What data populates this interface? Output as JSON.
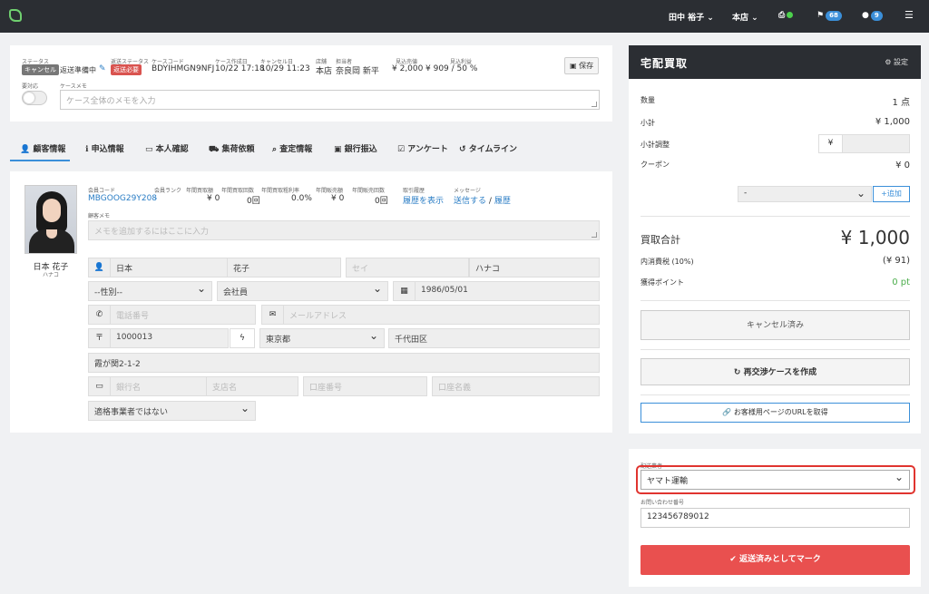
{
  "topbar": {
    "user": "田中 裕子 ⌄",
    "store": "本店 ⌄",
    "flag_count": "68",
    "chat_count": "9"
  },
  "case_header": {
    "status_label": "ステータス",
    "status_tag": "キャンセル",
    "status_text": "返送準備中",
    "return_status_label": "返送ステータス",
    "return_status_tag": "返送必要",
    "case_code_label": "ケースコード",
    "case_code": "BDYIHMGN9NFJ",
    "created_label": "ケース作成日",
    "created": "10/22 17:18",
    "cancel_label": "キャンセル日",
    "cancel": "10/29 11:23",
    "store_label": "店舗",
    "store": "本店",
    "staff_label": "担当者",
    "staff": "奈良岡 新平",
    "est_sales_label": "見込売値",
    "est_sales": "¥ 2,000",
    "est_profit_label": "見込利益",
    "est_profit": "¥ 909 / 50 %",
    "save_label": "保存",
    "attention_label": "要対応",
    "memo_label": "ケースメモ",
    "memo_placeholder": "ケース全体のメモを入力"
  },
  "tabs": [
    {
      "label": "顧客情報"
    },
    {
      "label": "申込情報"
    },
    {
      "label": "本人確認"
    },
    {
      "label": "集荷依頼"
    },
    {
      "label": "査定情報"
    },
    {
      "label": "銀行振込"
    },
    {
      "label": "アンケート"
    },
    {
      "label": "タイムライン"
    }
  ],
  "customer": {
    "name": "日本 花子",
    "kana": "ハナコ",
    "member_code_label": "会員コード",
    "member_code": "MBGOOG29Y208",
    "rank_label": "会員ランク",
    "rank": "-",
    "annual_buy_amt_label": "年間買取額",
    "annual_buy_amt": "¥ 0",
    "annual_buy_cnt_label": "年間買取回数",
    "annual_buy_cnt": "0回",
    "annual_buy_rate_label": "年間買取粗利率",
    "annual_buy_rate": "0.0%",
    "annual_sell_amt_label": "年間販売額",
    "annual_sell_amt": "¥ 0",
    "annual_sell_cnt_label": "年間販売回数",
    "annual_sell_cnt": "0回",
    "history_label": "取引履歴",
    "history_link": "履歴を表示",
    "message_label": "メッセージ",
    "message_send": "送信する",
    "message_sep": "/",
    "message_history": "履歴",
    "memo_label": "顧客メモ",
    "memo_placeholder": "メモを追加するにはここに入力",
    "last_name": "日本",
    "first_name": "花子",
    "last_kana_ph": "セイ",
    "first_kana": "ハナコ",
    "gender": "--性別--",
    "occupation": "会社員",
    "birthday": "1986/05/01",
    "phone_ph": "電話番号",
    "email_ph": "メールアドレス",
    "zip": "1000013",
    "prefecture": "東京都",
    "city": "千代田区",
    "address": "霞が関2-1-2",
    "bank_ph": "銀行名",
    "branch_ph": "支店名",
    "account_no_ph": "口座番号",
    "account_name_ph": "口座名義",
    "invoice": "適格事業者ではない"
  },
  "right_panel": {
    "title": "宅配買取",
    "settings": "設定",
    "qty_label": "数量",
    "qty": "1 点",
    "subtotal_label": "小計",
    "subtotal": "¥ 1,000",
    "adjust_label": "小計調整",
    "adjust_prefix": "¥",
    "coupon_label": "クーポン",
    "coupon": "¥ 0",
    "coupon_select": "-",
    "add_label": "追加",
    "total_label": "買取合計",
    "total": "¥ 1,000",
    "tax_label": "内消費税 (10%)",
    "tax": "(¥ 91)",
    "points_label": "獲得ポイント",
    "points": "0 pt",
    "cancel_btn": "キャンセル済み",
    "renegotiate_btn": "再交渉ケースを作成",
    "url_btn": "お客様用ページのURLを取得"
  },
  "shipping": {
    "carrier_label": "配送業者",
    "carrier": "ヤマト運輸",
    "tracking_label": "お問い合わせ番号",
    "tracking": "123456789012",
    "mark_returned": "返送済みとしてマーク"
  }
}
